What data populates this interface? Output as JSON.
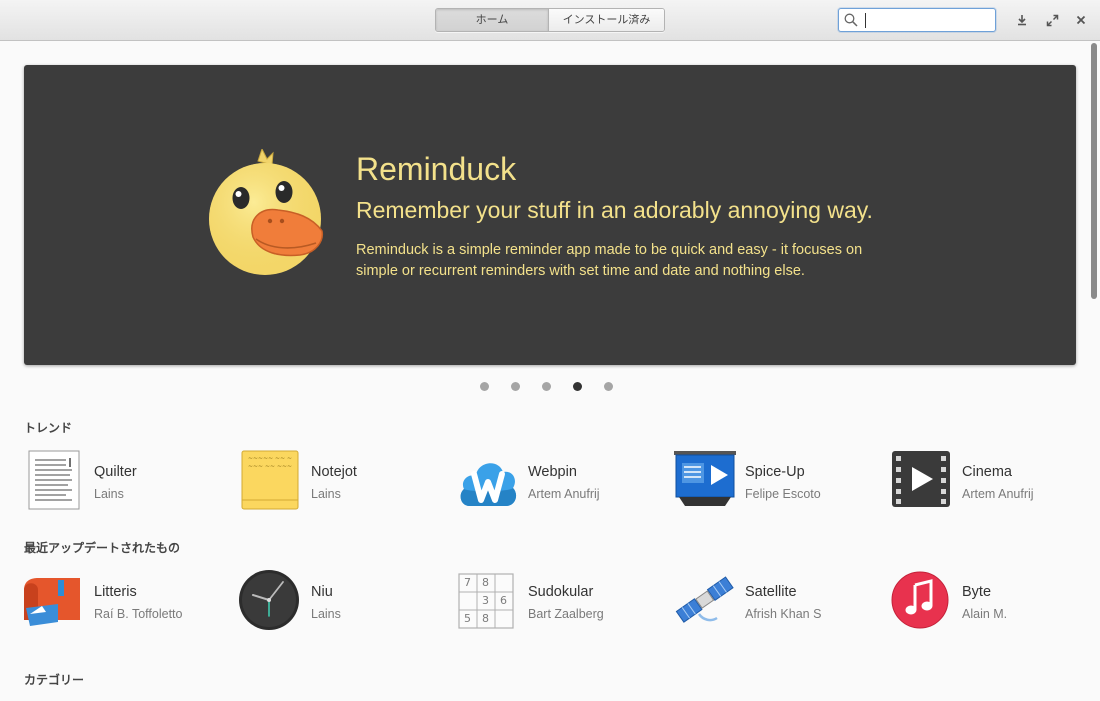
{
  "header": {
    "tabs": [
      {
        "label": "ホーム",
        "active": true
      },
      {
        "label": "インストール済み",
        "active": false
      }
    ],
    "search": {
      "value": "",
      "placeholder": ""
    },
    "controls": [
      "download-icon",
      "maximize-icon",
      "close-icon"
    ]
  },
  "banner": {
    "title": "Reminduck",
    "subtitle": "Remember your stuff in an adorably annoying way.",
    "description": "Reminduck is a simple reminder app made to be quick and easy - it focuses on simple or recurrent reminders with set time and date and nothing else.",
    "text_color": "#f3e18b",
    "background": "#3c3c3c",
    "slide_count": 5,
    "active_slide": 4
  },
  "sections": [
    {
      "title": "トレンド",
      "apps": [
        {
          "name": "Quilter",
          "author": "Lains",
          "icon": "quilter-icon"
        },
        {
          "name": "Notejot",
          "author": "Lains",
          "icon": "notejot-icon"
        },
        {
          "name": "Webpin",
          "author": "Artem Anufrij",
          "icon": "webpin-icon"
        },
        {
          "name": "Spice-Up",
          "author": "Felipe Escoto",
          "icon": "spice-up-icon"
        },
        {
          "name": "Cinema",
          "author": "Artem Anufrij",
          "icon": "cinema-icon"
        }
      ]
    },
    {
      "title": "最近アップデートされたもの",
      "apps": [
        {
          "name": "Litteris",
          "author": "Raí B. Toffoletto",
          "icon": "litteris-icon"
        },
        {
          "name": "Niu",
          "author": "Lains",
          "icon": "niu-icon"
        },
        {
          "name": "Sudokular",
          "author": "Bart Zaalberg",
          "icon": "sudokular-icon"
        },
        {
          "name": "Satellite",
          "author": "Afrish Khan S",
          "icon": "satellite-icon"
        },
        {
          "name": "Byte",
          "author": "Alain M.",
          "icon": "byte-icon"
        }
      ]
    },
    {
      "title": "カテゴリー",
      "apps": []
    }
  ]
}
